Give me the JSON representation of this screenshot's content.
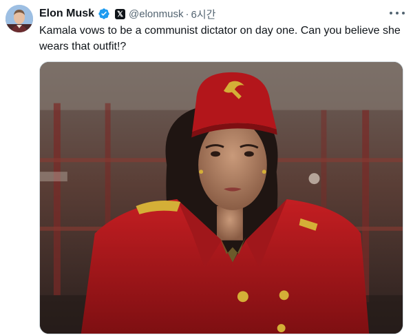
{
  "tweet": {
    "author": {
      "display_name": "Elon Musk",
      "handle": "@elonmusk",
      "verified": true,
      "affiliation_badge": "𝕏"
    },
    "timestamp": "6시간",
    "separator": "·",
    "text": "Kamala vows to be a communist dictator on day one. Can you believe she wears that outfit!?",
    "media": {
      "type": "image",
      "description_icon": "photo"
    },
    "more_menu": "more-options"
  },
  "colors": {
    "verified_blue": "#1d9bf0",
    "secondary_text": "#536471",
    "primary_text": "#0f1419",
    "jacket_red": "#b3161b"
  }
}
